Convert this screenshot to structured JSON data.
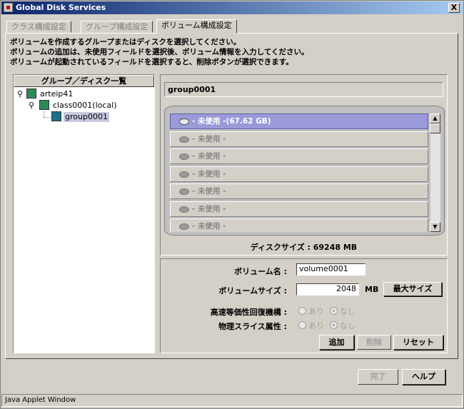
{
  "window": {
    "title": "Global Disk Services",
    "close_label": "X"
  },
  "tabs": [
    {
      "label": "クラス構成設定",
      "active": false
    },
    {
      "label": "グループ構成設定",
      "active": false
    },
    {
      "label": "ボリューム構成設定",
      "active": true
    }
  ],
  "instructions": [
    "ボリュームを作成するグループまたはディスクを選択してください。",
    "ボリュームの追加は、未使用フィールドを選択後、ボリューム情報を入力してください。",
    "ボリュームが起動されているフィールドを選択すると、削除ボタンが選択できます。"
  ],
  "tree": {
    "header": "グループ／ディスク一覧",
    "nodes": [
      {
        "label": "arteip41",
        "level": 0
      },
      {
        "label": "class0001(local)",
        "level": 1
      },
      {
        "label": "group0001",
        "level": 2,
        "selected": true
      }
    ]
  },
  "volume_view": {
    "group_label": "group0001",
    "volumes": [
      {
        "label": "- 未使用 -(67.62 GB)",
        "active": true
      },
      {
        "label": "- 未使用 -",
        "active": false
      },
      {
        "label": "- 未使用 -",
        "active": false
      },
      {
        "label": "- 未使用 -",
        "active": false
      },
      {
        "label": "- 未使用 -",
        "active": false
      },
      {
        "label": "- 未使用 -",
        "active": false
      },
      {
        "label": "- 未使用 -",
        "active": false
      }
    ],
    "disk_size": "ディスクサイズ : 69248 MB"
  },
  "form": {
    "volume_name_label": "ボリューム名 :",
    "volume_name_value": "volume0001",
    "volume_size_label": "ボリュームサイズ :",
    "volume_size_value": "2048",
    "size_unit": "MB",
    "max_size_button": "最大サイズ",
    "jrm_label": "高速等価性回復機構 :",
    "slice_label": "物理スライス属性 :",
    "radio_on": "あり",
    "radio_off": "なし",
    "add_button": "追加",
    "delete_button": "削除",
    "reset_button": "リセット"
  },
  "footer": {
    "done_button": "完了",
    "help_button": "ヘルプ"
  },
  "status": {
    "text": "Java Applet Window"
  },
  "colors": {
    "title_start": "#0a246a",
    "title_end": "#a6caf0",
    "selected_volume": "#9a9ad8",
    "face": "#d4d0c8"
  }
}
